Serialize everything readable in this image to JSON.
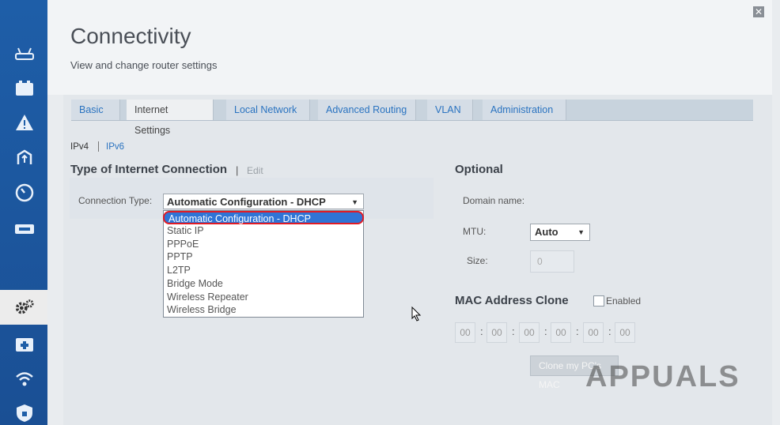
{
  "header": {
    "title": "Connectivity",
    "subtitle": "View and change router settings",
    "close": "✕"
  },
  "tabs": [
    {
      "label": "Basic"
    },
    {
      "label": "Internet Settings",
      "active": true
    },
    {
      "label": "Local Network"
    },
    {
      "label": "Advanced Routing"
    },
    {
      "label": "VLAN"
    },
    {
      "label": "Administration"
    }
  ],
  "ip_links": {
    "ipv4": "IPv4",
    "ipv6": "IPv6"
  },
  "connection": {
    "section_title": "Type of Internet Connection",
    "edit_label": "Edit",
    "type_label": "Connection Type:",
    "selected_value": "Automatic Configuration - DHCP",
    "options": [
      "Automatic Configuration - DHCP",
      "Static IP",
      "PPPoE",
      "PPTP",
      "L2TP",
      "Bridge Mode",
      "Wireless Repeater",
      "Wireless Bridge"
    ]
  },
  "optional": {
    "section_title": "Optional",
    "domain_label": "Domain name:",
    "mtu_label": "MTU:",
    "mtu_value": "Auto",
    "size_label": "Size:",
    "size_value": "0"
  },
  "mac_clone": {
    "section_title": "MAC Address Clone",
    "enabled_label": "Enabled",
    "octets": [
      "00",
      "00",
      "00",
      "00",
      "00",
      "00"
    ],
    "clone_button": "Clone my PC's MAC"
  },
  "watermark": "APPUALS",
  "sidebar_icons": [
    "router-icon",
    "network-map-icon",
    "alert-icon",
    "priority-icon",
    "speed-test-icon",
    "usb-icon",
    "settings-icon",
    "troubleshoot-icon",
    "wireless-icon",
    "security-icon"
  ],
  "colors": {
    "accent": "#2a73c0",
    "sidebar": "#1e5ea8",
    "highlight": "#2f74d6",
    "annotation": "#e11b24"
  }
}
